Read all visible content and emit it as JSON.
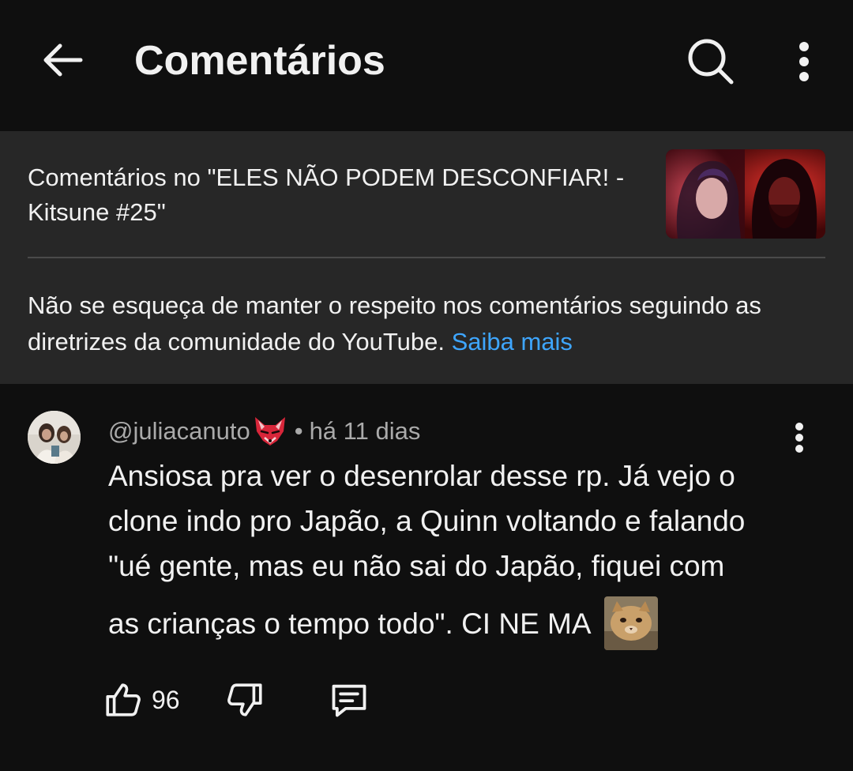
{
  "header": {
    "title": "Comentários",
    "icons": [
      "arrow-left-icon",
      "search-icon",
      "more-vertical-icon"
    ]
  },
  "info": {
    "video_title": "Comentários no \"ELES NÃO PODEM DESCONFIAR! - Kitsune #25\"",
    "guideline_text": "Não se esqueça de manter o respeito nos comentários seguindo as diretrizes da comunidade do YouTube.",
    "learn_more": "Saiba mais"
  },
  "comment": {
    "author": "@juliacanuto",
    "separator": "•",
    "time": "há 11 dias",
    "text_lines": [
      "Ansiosa pra ver o desenrolar desse rp. Já vejo o",
      "clone indo pro Japão, a Quinn voltando e falando",
      "\"ué gente, mas eu não sai do Japão, fiquei com",
      "as crianças o tempo todo\". CI NE MA"
    ],
    "likes": "96"
  },
  "colors": {
    "background": "#0f0f0f",
    "card": "#272727",
    "link": "#3ea6ff",
    "secondary_text": "#aaaaaa"
  }
}
